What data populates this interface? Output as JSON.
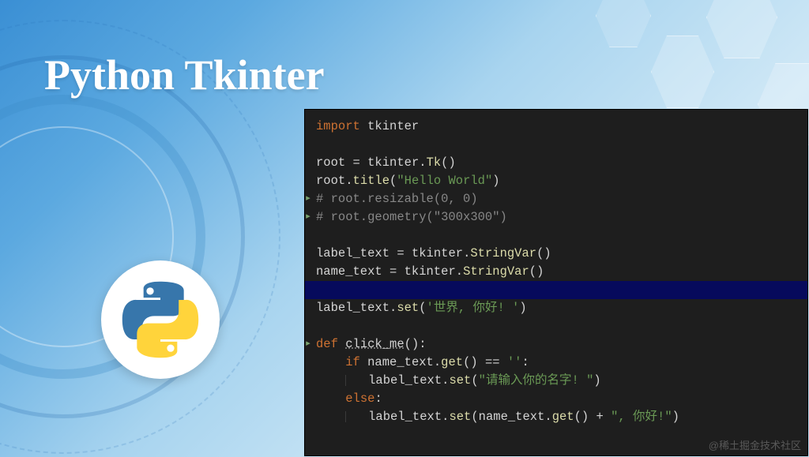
{
  "title": "Python Tkinter",
  "watermark": "@稀土掘金技术社区",
  "code": {
    "lines": [
      {
        "cursor": false,
        "gutter": "",
        "tokens": [
          [
            "kw",
            "import"
          ],
          [
            "nm",
            " tkinter"
          ]
        ]
      },
      {
        "cursor": false,
        "gutter": "",
        "tokens": []
      },
      {
        "cursor": false,
        "gutter": "",
        "tokens": [
          [
            "nm",
            "root "
          ],
          [
            "op",
            "="
          ],
          [
            "nm",
            " tkinter"
          ],
          [
            "op",
            "."
          ],
          [
            "fn",
            "Tk"
          ],
          [
            "op",
            "()"
          ]
        ]
      },
      {
        "cursor": false,
        "gutter": "",
        "tokens": [
          [
            "nm",
            "root"
          ],
          [
            "op",
            "."
          ],
          [
            "fn",
            "title"
          ],
          [
            "op",
            "("
          ],
          [
            "str",
            "\"Hello World\""
          ],
          [
            "op",
            ")"
          ]
        ]
      },
      {
        "cursor": false,
        "gutter": "g",
        "tokens": [
          [
            "cm",
            "# root.resizable(0, 0)"
          ]
        ]
      },
      {
        "cursor": false,
        "gutter": "g",
        "tokens": [
          [
            "cm",
            "# root.geometry(\"300x300\")"
          ]
        ]
      },
      {
        "cursor": false,
        "gutter": "",
        "tokens": []
      },
      {
        "cursor": false,
        "gutter": "",
        "tokens": [
          [
            "nm",
            "label_text "
          ],
          [
            "op",
            "="
          ],
          [
            "nm",
            " tkinter"
          ],
          [
            "op",
            "."
          ],
          [
            "fn",
            "StringVar"
          ],
          [
            "op",
            "()"
          ]
        ]
      },
      {
        "cursor": false,
        "gutter": "",
        "tokens": [
          [
            "nm",
            "name_text "
          ],
          [
            "op",
            "="
          ],
          [
            "nm",
            " tkinter"
          ],
          [
            "op",
            "."
          ],
          [
            "fn",
            "StringVar"
          ],
          [
            "op",
            "()"
          ]
        ]
      },
      {
        "cursor": true,
        "gutter": "",
        "tokens": []
      },
      {
        "cursor": false,
        "gutter": "",
        "tokens": [
          [
            "nm",
            "label_text"
          ],
          [
            "op",
            "."
          ],
          [
            "fn",
            "set"
          ],
          [
            "op",
            "("
          ],
          [
            "str",
            "'世界, 你好! '"
          ],
          [
            "op",
            ")"
          ]
        ]
      },
      {
        "cursor": false,
        "gutter": "",
        "tokens": []
      },
      {
        "cursor": false,
        "gutter": "g",
        "tokens": [
          [
            "kw",
            "def "
          ],
          [
            "id",
            "click_me"
          ],
          [
            "op",
            "():"
          ]
        ]
      },
      {
        "cursor": false,
        "gutter": "",
        "tokens": [
          [
            "indent",
            4
          ],
          [
            "kw",
            "if"
          ],
          [
            "nm",
            " name_text"
          ],
          [
            "op",
            "."
          ],
          [
            "fn",
            "get"
          ],
          [
            "op",
            "() "
          ],
          [
            "op",
            "=="
          ],
          [
            "str",
            " ''"
          ],
          [
            "op",
            ":"
          ]
        ]
      },
      {
        "cursor": false,
        "gutter": "",
        "tokens": [
          [
            "indent",
            4
          ],
          [
            "guide",
            ""
          ],
          [
            "indent",
            3
          ],
          [
            "nm",
            "label_text"
          ],
          [
            "op",
            "."
          ],
          [
            "fn",
            "set"
          ],
          [
            "op",
            "("
          ],
          [
            "str",
            "\"请输入你的名字! \""
          ],
          [
            "op",
            ")"
          ]
        ]
      },
      {
        "cursor": false,
        "gutter": "",
        "tokens": [
          [
            "indent",
            4
          ],
          [
            "kw",
            "else"
          ],
          [
            "op",
            ":"
          ]
        ]
      },
      {
        "cursor": false,
        "gutter": "",
        "tokens": [
          [
            "indent",
            4
          ],
          [
            "guide",
            ""
          ],
          [
            "indent",
            3
          ],
          [
            "nm",
            "label_text"
          ],
          [
            "op",
            "."
          ],
          [
            "fn",
            "set"
          ],
          [
            "op",
            "("
          ],
          [
            "nm",
            "name_text"
          ],
          [
            "op",
            "."
          ],
          [
            "fn",
            "get"
          ],
          [
            "op",
            "() "
          ],
          [
            "op",
            "+"
          ],
          [
            "str",
            " \", 你好!\""
          ],
          [
            "op",
            ")"
          ]
        ]
      }
    ]
  }
}
